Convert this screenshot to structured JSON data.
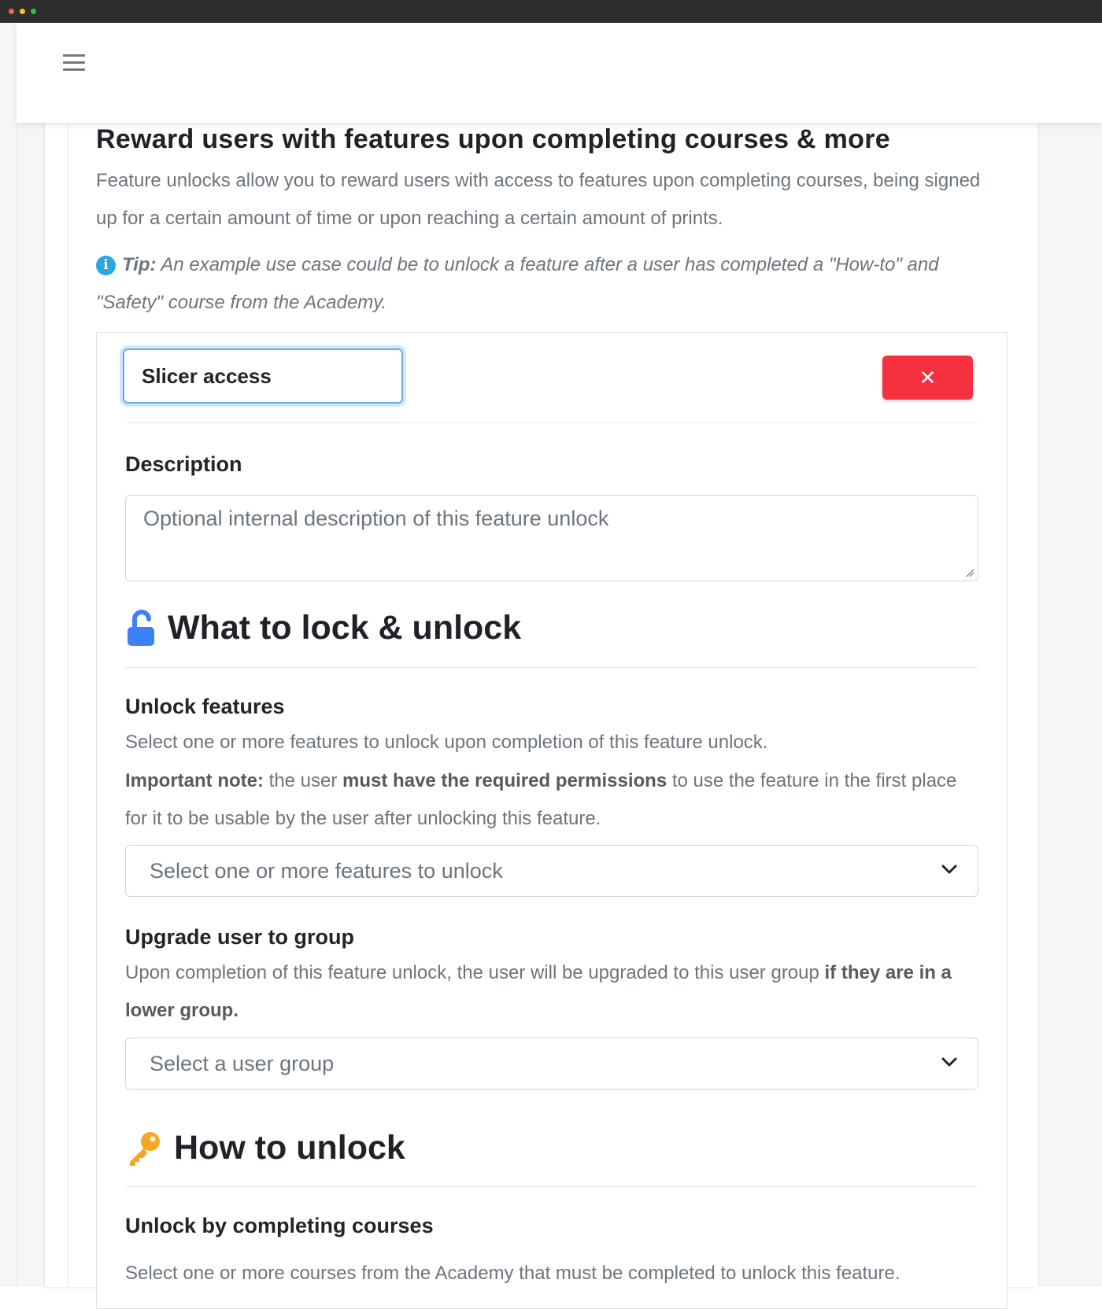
{
  "window": {
    "controls": [
      "close",
      "minimize",
      "maximize"
    ]
  },
  "topbar": {
    "menu_icon": "hamburger-menu-icon"
  },
  "header": {
    "title": "Reward users with features upon completing courses & more",
    "intro": "Feature unlocks allow you to reward users with access to features upon completing courses, being signed up for a certain amount of time or upon reaching a certain amount of prints.",
    "tip_label": "Tip:",
    "tip_text": " An example use case could be to unlock a feature after a user has completed a \"How-to\" and \"Safety\" course from the Academy."
  },
  "unlock_item": {
    "name_value": "Slicer access",
    "delete_icon": "close-icon",
    "description_label": "Description",
    "description_placeholder": "Optional internal description of this feature unlock"
  },
  "what_section": {
    "icon": "unlock-icon",
    "title": "What to lock & unlock",
    "unlock_features": {
      "label": "Unlock features",
      "help": "Select one or more features to unlock upon completion of this feature unlock.",
      "note_strong": "Important note:",
      "note_mid": " the user ",
      "note_strong2": "must have the required permissions",
      "note_end": " to use the feature in the first place for it to be usable by the user after unlocking this feature.",
      "select_placeholder": "Select one or more features to unlock"
    },
    "upgrade_group": {
      "label": "Upgrade user to group",
      "help": "Upon completion of this feature unlock, the user will be upgraded to this user group ",
      "help_strong": "if they are in a lower group.",
      "select_placeholder": "Select a user group"
    }
  },
  "how_section": {
    "icon": "key-icon",
    "title": "How to unlock",
    "courses": {
      "label": "Unlock by completing courses",
      "help": "Select one or more courses from the Academy that must be completed to unlock this feature."
    }
  },
  "colors": {
    "danger": "#f6303f",
    "focus_border": "#6fa8e6",
    "unlock_icon": "#3b82f6",
    "key_icon": "#f5a623",
    "tip_icon": "#2ba6e1"
  }
}
